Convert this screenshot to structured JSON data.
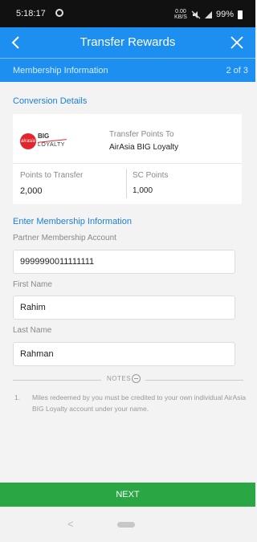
{
  "status_bar": {
    "time": "5:18:17",
    "net_top": "0.00",
    "net_bottom": "KB/S",
    "battery": "99%"
  },
  "header": {
    "title": "Transfer Rewards"
  },
  "subheader": {
    "section": "Membership Information",
    "step": "2 of 3"
  },
  "conversion": {
    "title": "Conversion Details",
    "logo_text_top": "BIG",
    "logo_text_bottom": "LOYALTY",
    "logo_badge": "airasia",
    "transfer_to_label": "Transfer Points To",
    "transfer_to_value": "AirAsia BIG Loyalty",
    "points_label": "Points to Transfer",
    "points_value": "2,000",
    "sc_label": "SC Points",
    "sc_value": "1,000"
  },
  "form": {
    "title": "Enter Membership Information",
    "account_label": "Partner Membership Account",
    "account_value": "9999990011111111",
    "first_name_label": "First Name",
    "first_name_value": "Rahim",
    "last_name_label": "Last Name",
    "last_name_value": "Rahman"
  },
  "notes": {
    "label": "NOTES",
    "items": [
      {
        "num": "1.",
        "text": "Miles redeemed by you must be credited to your own individual AirAsia BIG Loyalty account under your name."
      }
    ]
  },
  "footer": {
    "next_label": "NEXT"
  },
  "colors": {
    "header_blue": "#1d8ff0",
    "section_blue": "#1a7fd8",
    "next_green": "#2aa744",
    "brand_red": "#e1262d"
  }
}
